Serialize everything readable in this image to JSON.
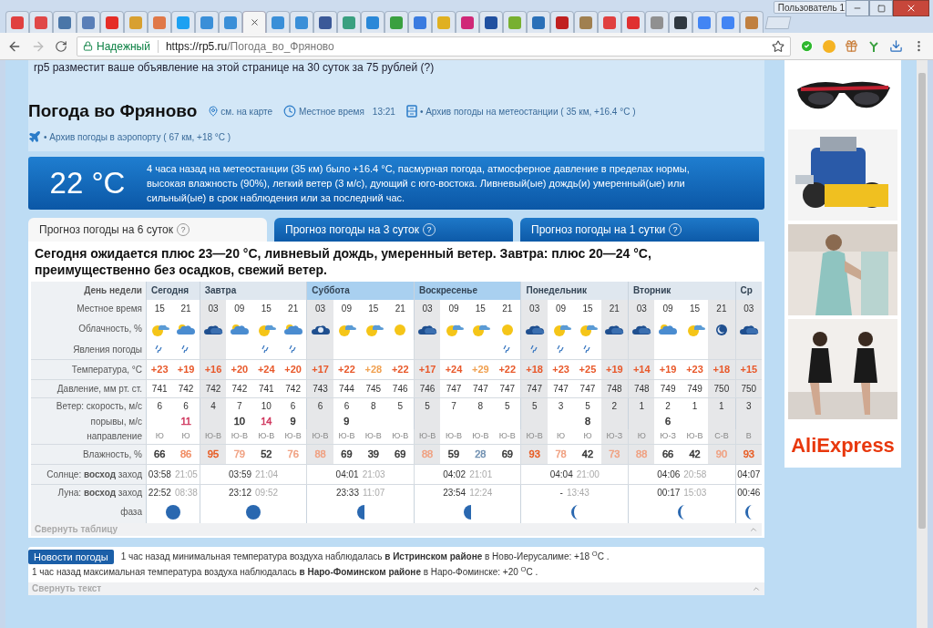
{
  "browser": {
    "tabs": [
      {
        "color": "#e04040",
        "selected": false
      },
      {
        "color": "#e04848",
        "selected": false
      },
      {
        "color": "#4a76a8",
        "selected": false
      },
      {
        "color": "#5a7fb8",
        "selected": false
      },
      {
        "color": "#e52d27",
        "selected": false
      },
      {
        "color": "#d8a030",
        "selected": false
      },
      {
        "color": "#e07848",
        "selected": false
      },
      {
        "color": "#1da1f2",
        "selected": false
      },
      {
        "color": "#3a8fd8",
        "selected": false
      },
      {
        "color": "#3a8fd8",
        "selected": false
      },
      {
        "selected": true
      },
      {
        "color": "#3a8fd8",
        "selected": false
      },
      {
        "color": "#3a8fd8",
        "selected": false
      },
      {
        "color": "#3b5998",
        "selected": false
      },
      {
        "color": "#3aa080",
        "selected": false
      },
      {
        "color": "#2a88d8",
        "selected": false
      },
      {
        "color": "#3aa040",
        "selected": false
      },
      {
        "color": "#3a7be0",
        "selected": false
      },
      {
        "color": "#e0b020",
        "selected": false
      },
      {
        "color": "#d02878",
        "selected": false
      },
      {
        "color": "#2050a0",
        "selected": false
      },
      {
        "color": "#78b030",
        "selected": false
      },
      {
        "color": "#2a70b8",
        "selected": false
      },
      {
        "color": "#c02020",
        "selected": false
      },
      {
        "color": "#a08050",
        "selected": false
      },
      {
        "color": "#e04040",
        "selected": false
      },
      {
        "color": "#e03030",
        "selected": false
      },
      {
        "color": "#909090",
        "selected": false
      },
      {
        "color": "#303840",
        "selected": false
      },
      {
        "color": "#4285f4",
        "selected": false
      },
      {
        "color": "#4285f4",
        "selected": false
      },
      {
        "color": "#c08040",
        "selected": false
      }
    ],
    "user": "Пользователь 1",
    "secure_label": "Надежный",
    "url_origin": "https://rp5.ru",
    "url_path": "/Погода_во_Фряново"
  },
  "promo": "rp5 разместит ваше объявление на этой странице на 30 суток за 75 рублей (?)",
  "header": {
    "title": "Погода во Фряново",
    "map_link": "см. на карте",
    "time_label": "Местное время",
    "time": "13:21",
    "station_archive": "• Архив погоды на метеостанции ( 35 км, +16.4 °C )",
    "airport_archive": "• Архив погоды в аэропорту ( 67 км, +18 °C )"
  },
  "current": {
    "temperature": "22 °C",
    "description": "4 часа назад на метеостанции (35 км) было +16.4 °C, пасмурная погода, атмосферное давление в пределах нормы, высокая влажность (90%), легкий ветер (3 м/с), дующий с юго-востока. Ливневый(ые) дождь(и) умеренный(ые) или сильный(ые) в срок наблюдения или за последний час."
  },
  "forecast_tabs": [
    {
      "label": "Прогноз погоды на 6 суток",
      "help": "?",
      "selected": true
    },
    {
      "label": "Прогноз погоды на 3 суток",
      "help": "?",
      "selected": false
    },
    {
      "label": "Прогноз погоды на 1 сутки",
      "help": "?",
      "selected": false
    }
  ],
  "summary": "Сегодня ожидается плюс 23—20 °C, ливневый дождь, умеренный ветер. Завтра: плюс 20—24 °C, преимущественно без осадков, свежий ветер.",
  "forecast": {
    "row_labels": {
      "day": "День недели",
      "time": "Местное время",
      "clouds": "Облачность, %",
      "phenomena": "Явления погоды",
      "temperature": "Температура, °C",
      "pressure": "Давление, мм рт. ст.",
      "wind_speed": "Ветер: скорость, м/с",
      "gusts": "порывы, м/с",
      "direction": "направление",
      "humidity": "Влажность, %",
      "sun": "Солнце: **восход** заход",
      "moon": "Луна: **восход** заход",
      "phase": "фаза"
    },
    "days": [
      {
        "name": "Сегодня",
        "weekend": false,
        "sunrise": "03:58",
        "sunset": "21:05",
        "moonrise": "22:52",
        "moonset": "08:38",
        "moon_phase": {
          "kind": "full"
        },
        "columns": [
          {
            "time": "15",
            "night": false,
            "sky": {
              "kind": "partly"
            },
            "rain": true,
            "temp": {
              "text": "+23",
              "color": "#e8582a"
            },
            "pressure": "741",
            "wind": "6",
            "direction": "Ю",
            "humidity": {
              "text": "66",
              "color": "#333333"
            }
          },
          {
            "time": "21",
            "night": false,
            "sky": {
              "kind": "cloudy"
            },
            "rain": true,
            "temp": {
              "text": "+19",
              "color": "#e8582a"
            },
            "pressure": "742",
            "wind": "6",
            "gust": {
              "text": "11",
              "color": "#d03a60"
            },
            "direction": "Ю",
            "humidity": {
              "text": "86",
              "color": "#f08a60"
            }
          }
        ]
      },
      {
        "name": "Завтра",
        "weekend": false,
        "sunrise": "03:59",
        "sunset": "21:04",
        "moonrise": "23:12",
        "moonset": "09:52",
        "moon_phase": {
          "kind": "full"
        },
        "columns": [
          {
            "time": "03",
            "night": true,
            "sky": {
              "kind": "overcast"
            },
            "rain": false,
            "temp": {
              "text": "+16",
              "color": "#e8582a"
            },
            "pressure": "742",
            "wind": "4",
            "direction": "Ю-В",
            "humidity": {
              "text": "95",
              "color": "#e85a20"
            }
          },
          {
            "time": "09",
            "night": false,
            "sky": {
              "kind": "cloudy"
            },
            "rain": false,
            "temp": {
              "text": "+20",
              "color": "#e8582a"
            },
            "pressure": "742",
            "wind": "7",
            "gust": {
              "text": "10",
              "color": "#333333"
            },
            "direction": "Ю-В",
            "humidity": {
              "text": "79",
              "color": "#f0a080"
            }
          },
          {
            "time": "15",
            "night": false,
            "sky": {
              "kind": "partly"
            },
            "rain": true,
            "temp": {
              "text": "+24",
              "color": "#e8582a"
            },
            "pressure": "741",
            "wind": "10",
            "gust": {
              "text": "14",
              "color": "#d03a60"
            },
            "direction": "Ю-В",
            "humidity": {
              "text": "52",
              "color": "#333333"
            }
          },
          {
            "time": "21",
            "night": false,
            "sky": {
              "kind": "cloudy"
            },
            "rain": true,
            "temp": {
              "text": "+20",
              "color": "#e8582a"
            },
            "pressure": "742",
            "wind": "6",
            "gust": {
              "text": "9",
              "color": "#333333"
            },
            "direction": "Ю-В",
            "humidity": {
              "text": "76",
              "color": "#f0a080"
            }
          }
        ]
      },
      {
        "name": "Суббота",
        "weekend": true,
        "sunrise": "04:01",
        "sunset": "21:03",
        "moonrise": "23:33",
        "moonset": "11:07",
        "moon_phase": {
          "kind": "gibbous"
        },
        "columns": [
          {
            "time": "03",
            "night": true,
            "sky": {
              "kind": "moon-cloud"
            },
            "rain": false,
            "temp": {
              "text": "+17",
              "color": "#e8582a"
            },
            "pressure": "743",
            "wind": "6",
            "direction": "Ю-В",
            "humidity": {
              "text": "88",
              "color": "#f0a080"
            }
          },
          {
            "time": "09",
            "night": false,
            "sky": {
              "kind": "partly"
            },
            "rain": false,
            "temp": {
              "text": "+22",
              "color": "#e8582a"
            },
            "pressure": "744",
            "wind": "6",
            "gust": {
              "text": "9",
              "color": "#333333"
            },
            "direction": "Ю-В",
            "humidity": {
              "text": "69",
              "color": "#333333"
            }
          },
          {
            "time": "15",
            "night": false,
            "sky": {
              "kind": "partly"
            },
            "rain": false,
            "temp": {
              "text": "+28",
              "color": "#f0a050"
            },
            "pressure": "745",
            "wind": "8",
            "direction": "Ю-В",
            "humidity": {
              "text": "39",
              "color": "#333333"
            }
          },
          {
            "time": "21",
            "night": false,
            "sky": {
              "kind": "sun"
            },
            "rain": false,
            "temp": {
              "text": "+22",
              "color": "#e8582a"
            },
            "pressure": "746",
            "wind": "5",
            "direction": "Ю-В",
            "humidity": {
              "text": "69",
              "color": "#333333"
            }
          }
        ]
      },
      {
        "name": "Воскресенье",
        "weekend": true,
        "sunrise": "04:02",
        "sunset": "21:01",
        "moonrise": "23:54",
        "moonset": "12:24",
        "moon_phase": {
          "kind": "gibbous"
        },
        "columns": [
          {
            "time": "03",
            "night": true,
            "sky": {
              "kind": "overcast"
            },
            "rain": false,
            "temp": {
              "text": "+17",
              "color": "#e8582a"
            },
            "pressure": "746",
            "wind": "5",
            "direction": "Ю-В",
            "humidity": {
              "text": "88",
              "color": "#f0a080"
            }
          },
          {
            "time": "09",
            "night": false,
            "sky": {
              "kind": "partly"
            },
            "rain": false,
            "temp": {
              "text": "+24",
              "color": "#e8582a"
            },
            "pressure": "747",
            "wind": "7",
            "direction": "Ю-В",
            "humidity": {
              "text": "59",
              "color": "#333333"
            }
          },
          {
            "time": "15",
            "night": false,
            "sky": {
              "kind": "partly"
            },
            "rain": false,
            "temp": {
              "text": "+29",
              "color": "#f0a050"
            },
            "pressure": "747",
            "wind": "8",
            "direction": "Ю-В",
            "humidity": {
              "text": "28",
              "color": "#6f8fb0"
            }
          },
          {
            "time": "21",
            "night": false,
            "sky": {
              "kind": "sun"
            },
            "rain": true,
            "temp": {
              "text": "+22",
              "color": "#e8582a"
            },
            "pressure": "747",
            "wind": "5",
            "direction": "Ю-В",
            "humidity": {
              "text": "69",
              "color": "#333333"
            }
          }
        ]
      },
      {
        "name": "Понедельник",
        "weekend": false,
        "sunrise": "04:04",
        "sunset": "21:00",
        "moonrise": "-",
        "moonset": "13:43",
        "moon_phase": {
          "kind": "crescent"
        },
        "columns": [
          {
            "time": "03",
            "night": true,
            "sky": {
              "kind": "overcast"
            },
            "rain": true,
            "temp": {
              "text": "+18",
              "color": "#e8582a"
            },
            "pressure": "747",
            "wind": "5",
            "direction": "Ю-В",
            "humidity": {
              "text": "93",
              "color": "#e85a20"
            }
          },
          {
            "time": "09",
            "night": false,
            "sky": {
              "kind": "partly"
            },
            "rain": true,
            "temp": {
              "text": "+23",
              "color": "#e8582a"
            },
            "pressure": "747",
            "wind": "3",
            "direction": "Ю",
            "humidity": {
              "text": "78",
              "color": "#f0a080"
            }
          },
          {
            "time": "15",
            "night": false,
            "sky": {
              "kind": "partly"
            },
            "rain": true,
            "temp": {
              "text": "+25",
              "color": "#e8582a"
            },
            "pressure": "747",
            "wind": "5",
            "gust": {
              "text": "8",
              "color": "#333333"
            },
            "direction": "Ю",
            "humidity": {
              "text": "42",
              "color": "#333333"
            }
          },
          {
            "time": "21",
            "night": true,
            "sky": {
              "kind": "overcast"
            },
            "rain": false,
            "temp": {
              "text": "+19",
              "color": "#e8582a"
            },
            "pressure": "748",
            "wind": "2",
            "direction": "Ю-З",
            "humidity": {
              "text": "73",
              "color": "#f0a080"
            }
          }
        ]
      },
      {
        "name": "Вторник",
        "weekend": false,
        "sunrise": "04:06",
        "sunset": "20:58",
        "moonrise": "00:17",
        "moonset": "15:03",
        "moon_phase": {
          "kind": "crescent"
        },
        "columns": [
          {
            "time": "03",
            "night": true,
            "sky": {
              "kind": "overcast"
            },
            "rain": false,
            "temp": {
              "text": "+14",
              "color": "#e8582a"
            },
            "pressure": "748",
            "wind": "1",
            "direction": "Ю",
            "humidity": {
              "text": "88",
              "color": "#f0a080"
            }
          },
          {
            "time": "09",
            "night": false,
            "sky": {
              "kind": "cloudy"
            },
            "rain": false,
            "temp": {
              "text": "+19",
              "color": "#e8582a"
            },
            "pressure": "749",
            "wind": "2",
            "gust": {
              "text": "6",
              "color": "#333333"
            },
            "direction": "Ю-З",
            "humidity": {
              "text": "66",
              "color": "#333333"
            }
          },
          {
            "time": "15",
            "night": false,
            "sky": {
              "kind": "partly"
            },
            "rain": false,
            "temp": {
              "text": "+23",
              "color": "#e8582a"
            },
            "pressure": "749",
            "wind": "1",
            "direction": "Ю-В",
            "humidity": {
              "text": "42",
              "color": "#333333"
            }
          },
          {
            "time": "21",
            "night": true,
            "sky": {
              "kind": "moon"
            },
            "rain": false,
            "temp": {
              "text": "+18",
              "color": "#e8582a"
            },
            "pressure": "750",
            "wind": "1",
            "direction": "С-В",
            "humidity": {
              "text": "90",
              "color": "#f0a080"
            }
          }
        ]
      },
      {
        "name": "Ср",
        "weekend": false,
        "sunrise": "04:07",
        "moonrise": "00:46",
        "moon_phase": {
          "kind": "crescent"
        },
        "columns": [
          {
            "time": "03",
            "night": true,
            "sky": {
              "kind": "overcast"
            },
            "rain": false,
            "temp": {
              "text": "+15",
              "color": "#e8582a"
            },
            "pressure": "750",
            "wind": "3",
            "direction": "В",
            "humidity": {
              "text": "93",
              "color": "#e85a20"
            }
          }
        ]
      }
    ]
  },
  "collapse_table": "Свернуть таблицу",
  "news": {
    "badge": "Новости погоды",
    "items": [
      "1 час назад минимальная температура воздуха наблюдалась **в Истринском районе** в Ново-Иерусалиме: +18 $^{O}$C .",
      "1 час назад максимальная температура воздуха наблюдалась **в Наро-Фоминском районе** в Наро-Фоминске: +20 $^{O}$C ."
    ],
    "collapse": "Свернуть текст"
  },
  "sidebar": {
    "logo": "AliExpress"
  }
}
